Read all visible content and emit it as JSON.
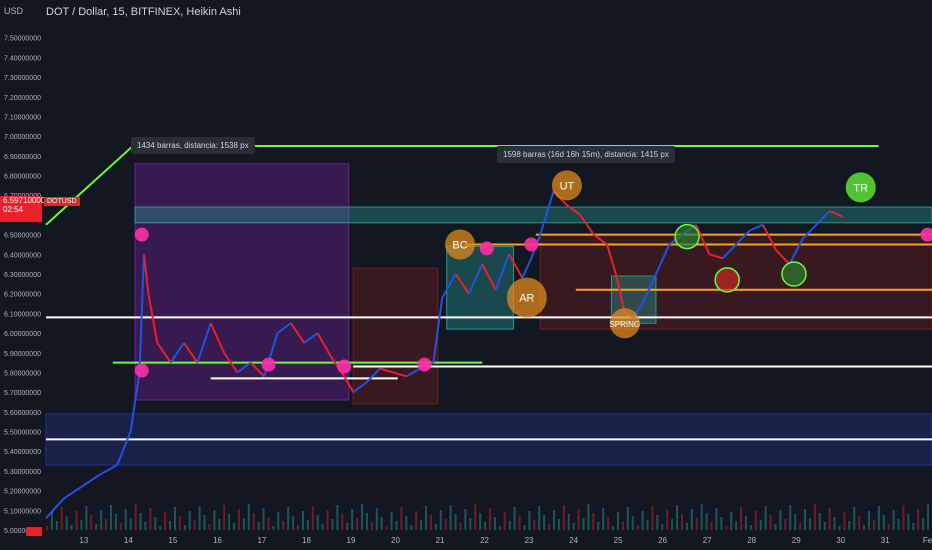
{
  "header": {
    "unit": "USD",
    "title": "DOT / Dollar, 15, BITFINEX, Heikin Ashi"
  },
  "price_tag": {
    "symbol": "DOTUSD",
    "price": "6.59710000",
    "timer": "02:54"
  },
  "measure_tooltips": [
    {
      "text": "1434 barras, distancia: 1538 px"
    },
    {
      "text": "1598 barras (16d 16h 15m), distancia: 1415 px"
    }
  ],
  "colors": {
    "background": "#131722",
    "candle_up": "#1e53e5",
    "candle_down": "#e8222b",
    "green_line": "#66ff33",
    "white_line": "#ffffff",
    "orange_line": "#f7a51c",
    "teal_zone": "#26a69a",
    "purple_zone": "#7b1fa2",
    "maroon_zone": "#7f1d1d",
    "navy_zone": "#283593",
    "marker_pink": "#ff2fa6",
    "marker_orange": "#e08a1e"
  },
  "chart_data": {
    "type": "candlestick",
    "title": "DOT / Dollar, 15, BITFINEX, Heikin Ashi",
    "ylabel": "USD",
    "ylim": [
      5.0,
      7.6
    ],
    "y_ticks": [
      "7.50000000",
      "7.40000000",
      "7.30000000",
      "7.20000000",
      "7.10000000",
      "7.00000000",
      "6.90000000",
      "6.80000000",
      "6.70000000",
      "6.60000000",
      "6.50000000",
      "6.40000000",
      "6.30000000",
      "6.20000000",
      "6.10000000",
      "6.00000000",
      "5.90000000",
      "5.80000000",
      "5.70000000",
      "5.60000000",
      "5.50000000",
      "5.40000000",
      "5.30000000",
      "5.20000000",
      "5.10000000",
      "5.00000000"
    ],
    "x_ticks": [
      "13",
      "14",
      "15",
      "16",
      "17",
      "18",
      "19",
      "20",
      "21",
      "22",
      "23",
      "24",
      "25",
      "26",
      "27",
      "28",
      "29",
      "30",
      "31",
      "Feb"
    ],
    "x_range": [
      12.1,
      32.0
    ],
    "price_path": [
      [
        12.1,
        5.06
      ],
      [
        12.5,
        5.16
      ],
      [
        12.9,
        5.22
      ],
      [
        13.3,
        5.28
      ],
      [
        13.7,
        5.33
      ],
      [
        14.0,
        5.5
      ],
      [
        14.2,
        5.8
      ],
      [
        14.3,
        6.4
      ],
      [
        14.4,
        6.2
      ],
      [
        14.6,
        5.95
      ],
      [
        14.9,
        5.85
      ],
      [
        15.2,
        5.95
      ],
      [
        15.5,
        5.85
      ],
      [
        15.8,
        6.05
      ],
      [
        16.1,
        5.9
      ],
      [
        16.4,
        5.8
      ],
      [
        16.7,
        5.85
      ],
      [
        17.0,
        5.78
      ],
      [
        17.3,
        6.0
      ],
      [
        17.6,
        6.05
      ],
      [
        17.9,
        5.95
      ],
      [
        18.2,
        6.0
      ],
      [
        18.5,
        5.88
      ],
      [
        18.8,
        5.78
      ],
      [
        19.0,
        5.7
      ],
      [
        19.3,
        5.75
      ],
      [
        19.6,
        5.82
      ],
      [
        19.9,
        5.8
      ],
      [
        20.2,
        5.78
      ],
      [
        20.5,
        5.82
      ],
      [
        20.8,
        5.85
      ],
      [
        21.0,
        6.18
      ],
      [
        21.3,
        6.3
      ],
      [
        21.6,
        6.2
      ],
      [
        21.9,
        6.35
      ],
      [
        22.2,
        6.22
      ],
      [
        22.5,
        6.4
      ],
      [
        22.8,
        6.28
      ],
      [
        23.0,
        6.38
      ],
      [
        23.2,
        6.5
      ],
      [
        23.5,
        6.72
      ],
      [
        23.8,
        6.65
      ],
      [
        24.1,
        6.6
      ],
      [
        24.4,
        6.5
      ],
      [
        24.7,
        6.45
      ],
      [
        24.9,
        6.3
      ],
      [
        25.1,
        6.1
      ],
      [
        25.3,
        6.08
      ],
      [
        25.5,
        6.15
      ],
      [
        25.8,
        6.3
      ],
      [
        26.1,
        6.45
      ],
      [
        26.4,
        6.5
      ],
      [
        26.7,
        6.55
      ],
      [
        27.0,
        6.4
      ],
      [
        27.3,
        6.38
      ],
      [
        27.6,
        6.45
      ],
      [
        27.9,
        6.52
      ],
      [
        28.2,
        6.55
      ],
      [
        28.5,
        6.42
      ],
      [
        28.8,
        6.35
      ],
      [
        29.1,
        6.48
      ],
      [
        29.4,
        6.55
      ],
      [
        29.7,
        6.62
      ],
      [
        30.0,
        6.59
      ]
    ],
    "horizontal_levels": [
      {
        "price": 6.95,
        "x": [
          14.1,
          30.8
        ],
        "color": "green_line"
      },
      {
        "price": 6.08,
        "x": [
          12.1,
          32.0
        ],
        "color": "white_line"
      },
      {
        "price": 5.85,
        "x": [
          13.6,
          21.9
        ],
        "color": "green_line"
      },
      {
        "price": 5.83,
        "x": [
          19.0,
          32.0
        ],
        "color": "white_line"
      },
      {
        "price": 5.77,
        "x": [
          15.8,
          20.0
        ],
        "color": "white_line"
      },
      {
        "price": 5.46,
        "x": [
          12.1,
          32.0
        ],
        "color": "white_line"
      },
      {
        "price": 6.45,
        "x": [
          21.5,
          32.0
        ],
        "color": "orange_line"
      },
      {
        "price": 6.22,
        "x": [
          24.0,
          32.0
        ],
        "color": "orange_line"
      },
      {
        "price": 6.5,
        "x": [
          23.1,
          32.0
        ],
        "color": "orange_line"
      }
    ],
    "zones": [
      {
        "x": [
          14.1,
          18.9
        ],
        "y": [
          5.66,
          6.86
        ],
        "color": "purple_zone"
      },
      {
        "x": [
          19.0,
          20.9
        ],
        "y": [
          5.64,
          6.33
        ],
        "color": "maroon_zone"
      },
      {
        "x": [
          14.1,
          32.0
        ],
        "y": [
          6.56,
          6.64
        ],
        "color": "teal_zone"
      },
      {
        "x": [
          21.1,
          22.6
        ],
        "y": [
          6.02,
          6.44
        ],
        "color": "teal_zone"
      },
      {
        "x": [
          23.2,
          32.0
        ],
        "y": [
          6.02,
          6.5
        ],
        "color": "maroon_zone"
      },
      {
        "x": [
          24.8,
          25.8
        ],
        "y": [
          6.05,
          6.29
        ],
        "color": "teal_zone"
      },
      {
        "x": [
          12.1,
          32.0
        ],
        "y": [
          5.33,
          5.59
        ],
        "color": "navy_zone"
      }
    ],
    "labels": [
      {
        "text": "BC",
        "x": 21.4,
        "y": 6.45,
        "color": "marker_orange"
      },
      {
        "text": "UT",
        "x": 23.8,
        "y": 6.75,
        "color": "marker_orange"
      },
      {
        "text": "AR",
        "x": 22.9,
        "y": 6.18,
        "color": "marker_orange"
      },
      {
        "text": "SPRING",
        "x": 25.1,
        "y": 6.05,
        "color": "marker_orange"
      },
      {
        "text": "TR",
        "x": 30.4,
        "y": 6.74,
        "color": "green_line"
      }
    ]
  }
}
